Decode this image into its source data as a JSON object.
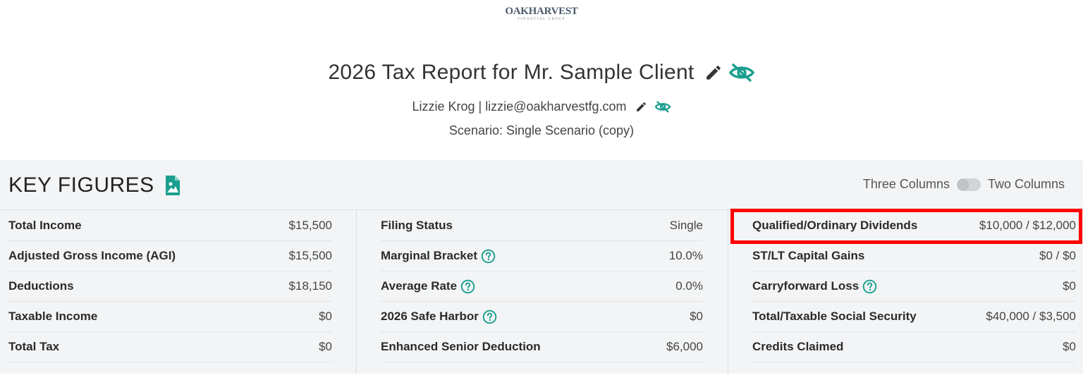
{
  "logo": {
    "brand": "OAKHARVEST",
    "sub": "FINANCIAL GROUP"
  },
  "header": {
    "title": "2026 Tax Report for Mr. Sample Client",
    "advisor_name": "Lizzie Krog",
    "separator": "|",
    "advisor_email": "lizzie@oakharvestfg.com",
    "scenario": "Scenario: Single Scenario (copy)"
  },
  "key_figures": {
    "title": "KEY FIGURES",
    "toggle": {
      "left_label": "Three Columns",
      "right_label": "Two Columns",
      "state": "off"
    },
    "columns": [
      [
        {
          "label": "Total Income",
          "value": "$15,500",
          "help": false
        },
        {
          "label": "Adjusted Gross Income (AGI)",
          "value": "$15,500",
          "help": false
        },
        {
          "label": "Deductions",
          "value": "$18,150",
          "help": false
        },
        {
          "label": "Taxable Income",
          "value": "$0",
          "help": false
        },
        {
          "label": "Total Tax",
          "value": "$0",
          "help": false
        }
      ],
      [
        {
          "label": "Filing Status",
          "value": "Single",
          "help": false
        },
        {
          "label": "Marginal Bracket",
          "value": "10.0%",
          "help": true
        },
        {
          "label": "Average Rate",
          "value": "0.0%",
          "help": true
        },
        {
          "label": "2026 Safe Harbor",
          "value": "$0",
          "help": true
        },
        {
          "label": "Enhanced Senior Deduction",
          "value": "$6,000",
          "help": false
        }
      ],
      [
        {
          "label": "Qualified/Ordinary Dividends",
          "value": "$10,000 / $12,000",
          "help": false
        },
        {
          "label": "ST/LT Capital Gains",
          "value": "$0 / $0",
          "help": false
        },
        {
          "label": "Carryforward Loss",
          "value": "$0",
          "help": true
        },
        {
          "label": "Total/Taxable Social Security",
          "value": "$40,000 / $3,500",
          "help": false
        },
        {
          "label": "Credits Claimed",
          "value": "$0",
          "help": false
        }
      ]
    ]
  },
  "colors": {
    "accent": "#1a9e8f",
    "highlight": "#ff0000",
    "panel": "#f3f4f5"
  },
  "icons": {
    "edit": "pencil-icon",
    "hide": "eye-slash-icon",
    "export": "image-file-icon",
    "help": "question-circle-icon"
  }
}
